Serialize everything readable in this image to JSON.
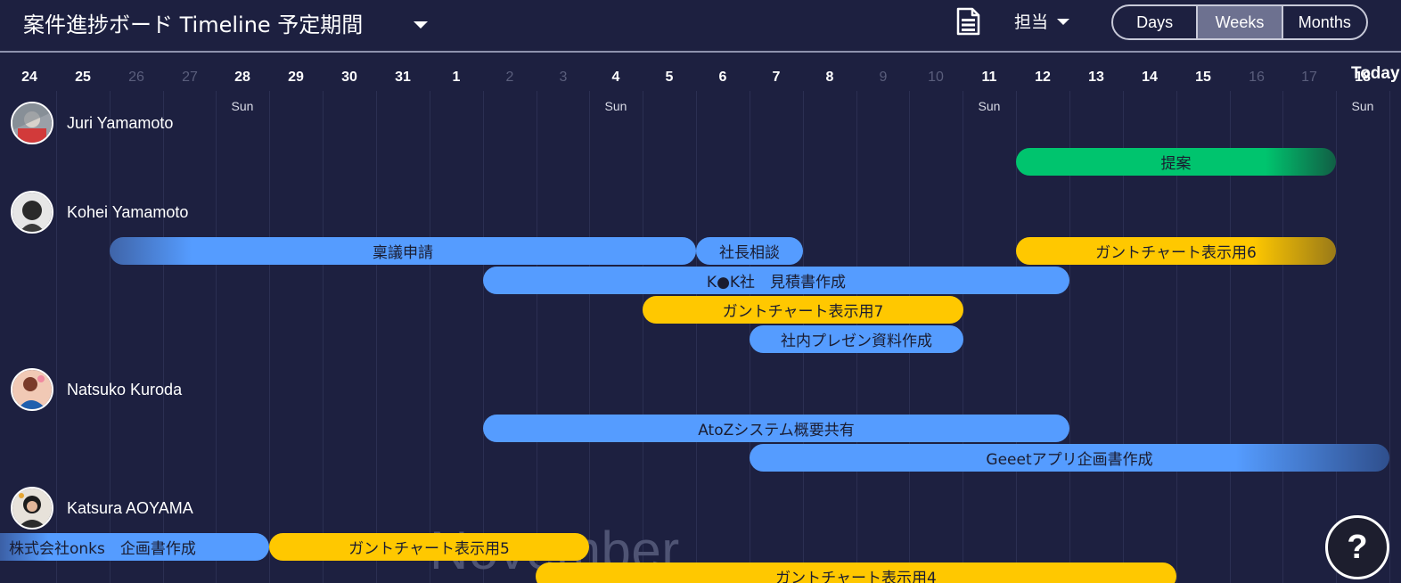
{
  "header": {
    "title": "案件進捗ボード  Timeline 予定期間",
    "assign_label": "担当",
    "views": [
      {
        "label": "Days",
        "active": false
      },
      {
        "label": "Weeks",
        "active": true
      },
      {
        "label": "Months",
        "active": false
      }
    ]
  },
  "timeline": {
    "today_label": "Today",
    "month_label": "November",
    "days": [
      {
        "label": "24",
        "weekend": false
      },
      {
        "label": "25",
        "weekend": false
      },
      {
        "label": "26",
        "weekend": true
      },
      {
        "label": "27",
        "weekend": true
      },
      {
        "label": "28",
        "weekend": false,
        "sub": "Sun"
      },
      {
        "label": "29",
        "weekend": false
      },
      {
        "label": "30",
        "weekend": false
      },
      {
        "label": "31",
        "weekend": false
      },
      {
        "label": "1",
        "weekend": false
      },
      {
        "label": "2",
        "weekend": true
      },
      {
        "label": "3",
        "weekend": true
      },
      {
        "label": "4",
        "weekend": false,
        "sub": "Sun"
      },
      {
        "label": "5",
        "weekend": false
      },
      {
        "label": "6",
        "weekend": false
      },
      {
        "label": "7",
        "weekend": false
      },
      {
        "label": "8",
        "weekend": false
      },
      {
        "label": "9",
        "weekend": true
      },
      {
        "label": "10",
        "weekend": true
      },
      {
        "label": "11",
        "weekend": false,
        "sub": "Sun"
      },
      {
        "label": "12",
        "weekend": false
      },
      {
        "label": "13",
        "weekend": false
      },
      {
        "label": "14",
        "weekend": false
      },
      {
        "label": "15",
        "weekend": false
      },
      {
        "label": "16",
        "weekend": true
      },
      {
        "label": "17",
        "weekend": true
      },
      {
        "label": "18",
        "weekend": false,
        "sub": "Sun"
      }
    ]
  },
  "people": [
    {
      "name": "Juri Yamamoto"
    },
    {
      "name": "Kohei Yamamoto"
    },
    {
      "name": "Natsuko Kuroda"
    },
    {
      "name": "Katsura AOYAMA"
    }
  ],
  "tasks": [
    {
      "label": "提案",
      "color": "#00c46e"
    },
    {
      "label": "稟議申請",
      "color": "#559cff"
    },
    {
      "label": "社長相談",
      "color": "#559cff"
    },
    {
      "label": "ガントチャート表示用6",
      "color": "#ffc800"
    },
    {
      "label": "K●K社　見積書作成",
      "color": "#559cff"
    },
    {
      "label": "ガントチャート表示用7",
      "color": "#ffc800"
    },
    {
      "label": "社内プレゼン資料作成",
      "color": "#559cff"
    },
    {
      "label": "AtoZシステム概要共有",
      "color": "#559cff"
    },
    {
      "label": "Geeetアプリ企画書作成",
      "color": "#559cff"
    },
    {
      "label": "株式会社onks　企画書作成",
      "color": "#559cff"
    },
    {
      "label": "ガントチャート表示用5",
      "color": "#ffc800"
    },
    {
      "label": "ガントチャート表示用4",
      "color": "#ffc800"
    }
  ],
  "help_label": "?"
}
